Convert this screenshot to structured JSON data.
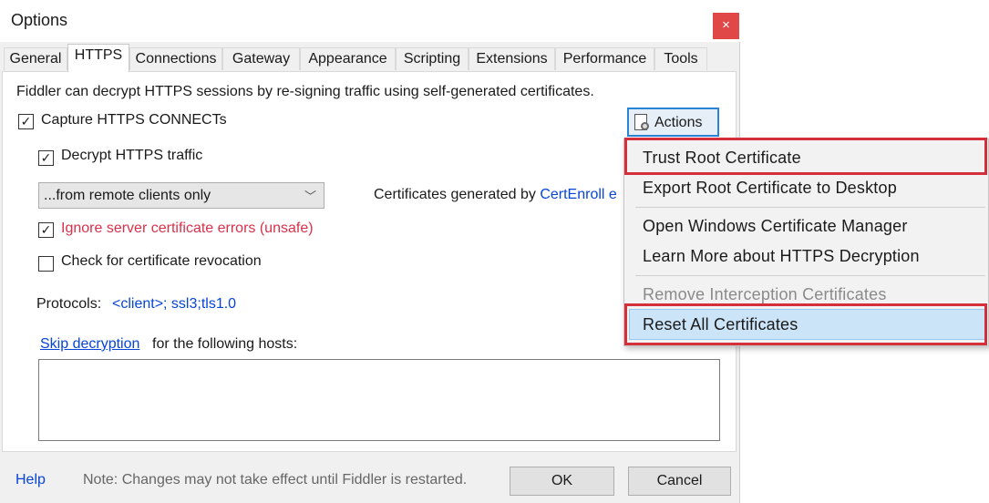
{
  "window": {
    "title": "Options",
    "close_glyph": "×"
  },
  "tabs": [
    {
      "label": "General"
    },
    {
      "label": "HTTPS"
    },
    {
      "label": "Connections"
    },
    {
      "label": "Gateway"
    },
    {
      "label": "Appearance"
    },
    {
      "label": "Scripting"
    },
    {
      "label": "Extensions"
    },
    {
      "label": "Performance"
    },
    {
      "label": "Tools"
    }
  ],
  "active_tab": "HTTPS",
  "https": {
    "intro": "Fiddler can decrypt HTTPS sessions by re-signing traffic using self-generated certificates.",
    "capture_label": "Capture HTTPS CONNECTs",
    "capture_checked": true,
    "decrypt_label": "Decrypt HTTPS traffic",
    "decrypt_checked": true,
    "source_select": "...from remote clients only",
    "certs_label": "Certificates generated by",
    "certs_link": "CertEnroll e",
    "ignore_label": "Ignore server certificate errors (unsafe)",
    "ignore_checked": true,
    "revocation_label": "Check for certificate revocation",
    "revocation_checked": false,
    "protocols_label": "Protocols:",
    "protocols_value": "<client>; ssl3;tls1.0",
    "skip_link": "Skip decryption",
    "skip_rest": "for the following hosts:",
    "hosts_value": "",
    "actions_label": "Actions"
  },
  "actions_menu": {
    "items": [
      {
        "label": "Trust Root Certificate",
        "enabled": true
      },
      {
        "label": "Export Root Certificate to Desktop",
        "enabled": true
      },
      {
        "label": "Open Windows Certificate Manager",
        "enabled": true
      },
      {
        "label": "Learn More about HTTPS Decryption",
        "enabled": true
      },
      {
        "label": "Remove Interception Certificates",
        "enabled": false
      },
      {
        "label": "Reset All Certificates",
        "enabled": true
      }
    ],
    "hovered_item": "Reset All Certificates",
    "highlight_color": "#d42f3a"
  },
  "footer": {
    "help": "Help",
    "note": "Note: Changes may not take effect until Fiddler is restarted.",
    "ok": "OK",
    "cancel": "Cancel"
  },
  "icons": {
    "checkmark": "✓",
    "chevron": "﹀",
    "close": "close-icon",
    "actions": "certificate-gear-icon"
  }
}
